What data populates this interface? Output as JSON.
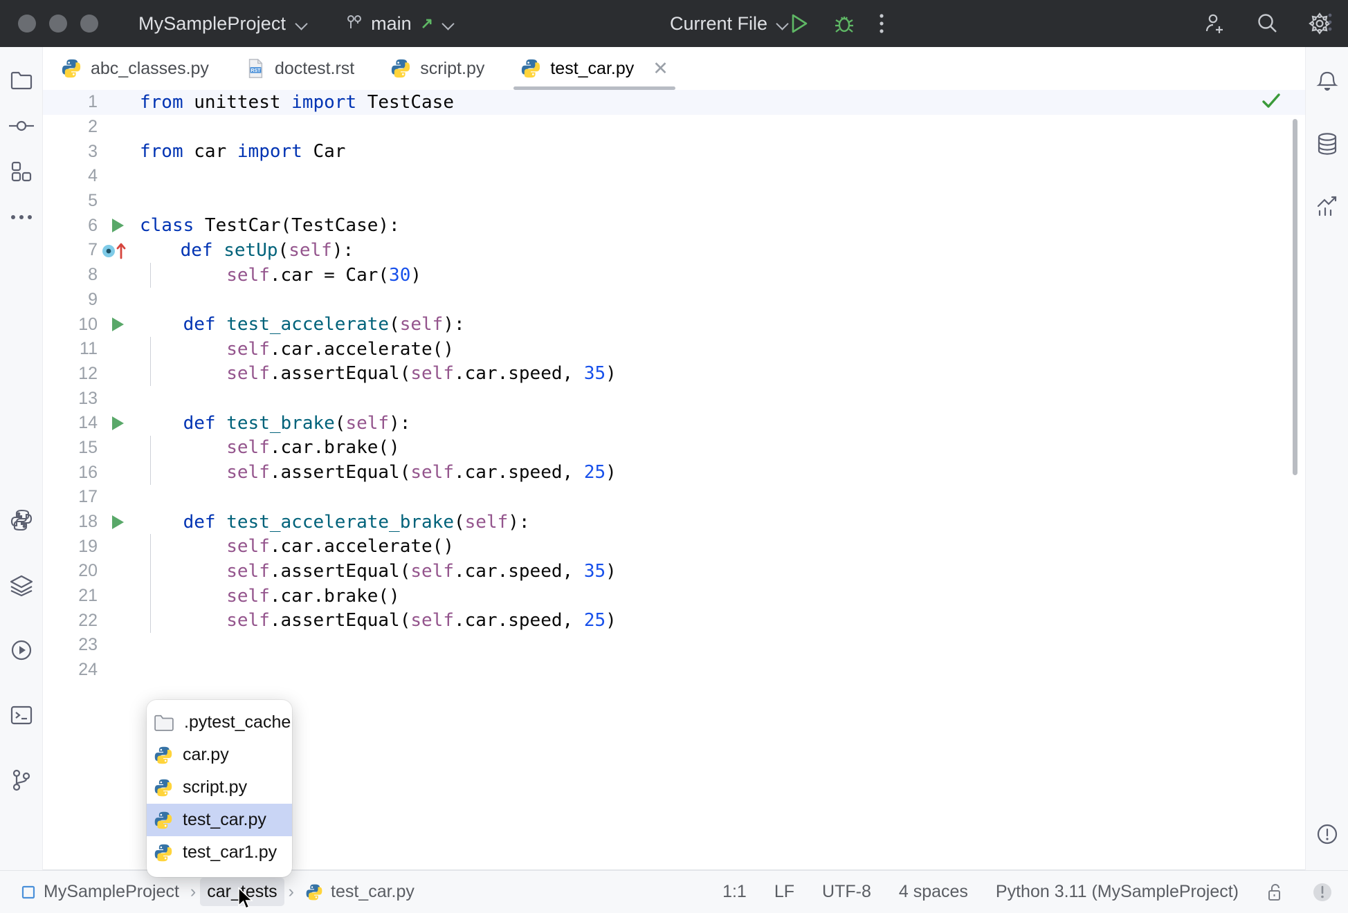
{
  "titlebar": {
    "project": "MySampleProject",
    "branch": "main",
    "branch_icon": "git-branch-icon",
    "branch_sync_icon": "arrow-up-right-icon",
    "run_config": "Current File",
    "run_icon": "run-play-icon",
    "debug_icon": "debug-bug-icon",
    "more_icon": "more-vertical-icon",
    "share_icon": "add-user-icon",
    "search_icon": "search-icon",
    "settings_icon": "gear-icon"
  },
  "left_rail": [
    {
      "name": "project-tool-window",
      "icon": "folder-icon"
    },
    {
      "name": "commit-tool-window",
      "icon": "commit-icon"
    },
    {
      "name": "plugins-tool-window",
      "icon": "plugins-icon"
    },
    {
      "name": "more-tool-windows",
      "icon": "ellipsis-icon"
    },
    {
      "name": "python-packages-tool-window",
      "icon": "python-icon"
    },
    {
      "name": "database-layers-tool-window",
      "icon": "layers-icon"
    },
    {
      "name": "run-tool-window",
      "icon": "run-circle-icon"
    },
    {
      "name": "terminal-tool-window",
      "icon": "terminal-icon"
    },
    {
      "name": "version-control-tool-window",
      "icon": "vcs-branch-icon"
    }
  ],
  "right_rail": [
    {
      "name": "notifications-tool-window",
      "icon": "bell-icon"
    },
    {
      "name": "database-tool-window",
      "icon": "database-icon"
    },
    {
      "name": "profiler-tool-window",
      "icon": "chart-icon"
    },
    {
      "name": "problems-tool-window",
      "icon": "alert-circle-icon"
    }
  ],
  "tabs": [
    {
      "label": "abc_classes.py",
      "icon": "python-file-icon",
      "active": false,
      "closable": false
    },
    {
      "label": "doctest.rst",
      "icon": "rst-file-icon",
      "active": false,
      "closable": false
    },
    {
      "label": "script.py",
      "icon": "python-file-icon",
      "active": false,
      "closable": false
    },
    {
      "label": "test_car.py",
      "icon": "python-file-icon",
      "active": true,
      "closable": true
    }
  ],
  "tabs_more_icon": "more-vertical-icon",
  "editor": {
    "inspection_status_icon": "checkmark-ok-icon",
    "lines": [
      {
        "n": "1",
        "gutter": "",
        "indent": 0,
        "current": true,
        "tokens": [
          {
            "t": "from",
            "c": "kw"
          },
          {
            "t": " unittest ",
            "c": ""
          },
          {
            "t": "import",
            "c": "kw"
          },
          {
            "t": " TestCase",
            "c": ""
          }
        ]
      },
      {
        "n": "2",
        "gutter": "",
        "indent": 0,
        "current": false,
        "tokens": []
      },
      {
        "n": "3",
        "gutter": "",
        "indent": 0,
        "current": false,
        "tokens": [
          {
            "t": "from",
            "c": "kw"
          },
          {
            "t": " car ",
            "c": ""
          },
          {
            "t": "import",
            "c": "kw"
          },
          {
            "t": " Car",
            "c": ""
          }
        ]
      },
      {
        "n": "4",
        "gutter": "",
        "indent": 0,
        "current": false,
        "tokens": []
      },
      {
        "n": "5",
        "gutter": "",
        "indent": 0,
        "current": false,
        "tokens": []
      },
      {
        "n": "6",
        "gutter": "run",
        "indent": 0,
        "current": false,
        "tokens": [
          {
            "t": "class",
            "c": "kw"
          },
          {
            "t": " TestCar(TestCase):",
            "c": ""
          }
        ]
      },
      {
        "n": "7",
        "gutter": "override",
        "indent": 0,
        "current": false,
        "tokens": [
          {
            "t": "    ",
            "c": ""
          },
          {
            "t": "def",
            "c": "kw"
          },
          {
            "t": " ",
            "c": ""
          },
          {
            "t": "setUp",
            "c": "fn"
          },
          {
            "t": "(",
            "c": ""
          },
          {
            "t": "self",
            "c": "slf"
          },
          {
            "t": "):",
            "c": ""
          }
        ]
      },
      {
        "n": "8",
        "gutter": "",
        "indent": 1,
        "current": false,
        "tokens": [
          {
            "t": "        ",
            "c": ""
          },
          {
            "t": "self",
            "c": "slf"
          },
          {
            "t": ".car = Car(",
            "c": ""
          },
          {
            "t": "30",
            "c": "num"
          },
          {
            "t": ")",
            "c": ""
          }
        ]
      },
      {
        "n": "9",
        "gutter": "",
        "indent": 0,
        "current": false,
        "tokens": []
      },
      {
        "n": "10",
        "gutter": "run",
        "indent": 0,
        "current": false,
        "tokens": [
          {
            "t": "    ",
            "c": ""
          },
          {
            "t": "def",
            "c": "kw"
          },
          {
            "t": " ",
            "c": ""
          },
          {
            "t": "test_accelerate",
            "c": "fn"
          },
          {
            "t": "(",
            "c": ""
          },
          {
            "t": "self",
            "c": "slf"
          },
          {
            "t": "):",
            "c": ""
          }
        ]
      },
      {
        "n": "11",
        "gutter": "",
        "indent": 1,
        "current": false,
        "tokens": [
          {
            "t": "        ",
            "c": ""
          },
          {
            "t": "self",
            "c": "slf"
          },
          {
            "t": ".car.accelerate()",
            "c": ""
          }
        ]
      },
      {
        "n": "12",
        "gutter": "",
        "indent": 1,
        "current": false,
        "tokens": [
          {
            "t": "        ",
            "c": ""
          },
          {
            "t": "self",
            "c": "slf"
          },
          {
            "t": ".assertEqual(",
            "c": ""
          },
          {
            "t": "self",
            "c": "slf"
          },
          {
            "t": ".car.speed, ",
            "c": ""
          },
          {
            "t": "35",
            "c": "num"
          },
          {
            "t": ")",
            "c": ""
          }
        ]
      },
      {
        "n": "13",
        "gutter": "",
        "indent": 0,
        "current": false,
        "tokens": []
      },
      {
        "n": "14",
        "gutter": "run",
        "indent": 0,
        "current": false,
        "tokens": [
          {
            "t": "    ",
            "c": ""
          },
          {
            "t": "def",
            "c": "kw"
          },
          {
            "t": " ",
            "c": ""
          },
          {
            "t": "test_brake",
            "c": "fn"
          },
          {
            "t": "(",
            "c": ""
          },
          {
            "t": "self",
            "c": "slf"
          },
          {
            "t": "):",
            "c": ""
          }
        ]
      },
      {
        "n": "15",
        "gutter": "",
        "indent": 1,
        "current": false,
        "tokens": [
          {
            "t": "        ",
            "c": ""
          },
          {
            "t": "self",
            "c": "slf"
          },
          {
            "t": ".car.brake()",
            "c": ""
          }
        ]
      },
      {
        "n": "16",
        "gutter": "",
        "indent": 1,
        "current": false,
        "tokens": [
          {
            "t": "        ",
            "c": ""
          },
          {
            "t": "self",
            "c": "slf"
          },
          {
            "t": ".assertEqual(",
            "c": ""
          },
          {
            "t": "self",
            "c": "slf"
          },
          {
            "t": ".car.speed, ",
            "c": ""
          },
          {
            "t": "25",
            "c": "num"
          },
          {
            "t": ")",
            "c": ""
          }
        ]
      },
      {
        "n": "17",
        "gutter": "",
        "indent": 0,
        "current": false,
        "tokens": []
      },
      {
        "n": "18",
        "gutter": "run",
        "indent": 0,
        "current": false,
        "tokens": [
          {
            "t": "    ",
            "c": ""
          },
          {
            "t": "def",
            "c": "kw"
          },
          {
            "t": " ",
            "c": ""
          },
          {
            "t": "test_accelerate_brake",
            "c": "fn"
          },
          {
            "t": "(",
            "c": ""
          },
          {
            "t": "self",
            "c": "slf"
          },
          {
            "t": "):",
            "c": ""
          }
        ]
      },
      {
        "n": "19",
        "gutter": "",
        "indent": 1,
        "current": false,
        "tokens": [
          {
            "t": "        ",
            "c": ""
          },
          {
            "t": "self",
            "c": "slf"
          },
          {
            "t": ".car.accelerate()",
            "c": ""
          }
        ]
      },
      {
        "n": "20",
        "gutter": "",
        "indent": 1,
        "current": false,
        "tokens": [
          {
            "t": "        ",
            "c": ""
          },
          {
            "t": "self",
            "c": "slf"
          },
          {
            "t": ".assertEqual(",
            "c": ""
          },
          {
            "t": "self",
            "c": "slf"
          },
          {
            "t": ".car.speed, ",
            "c": ""
          },
          {
            "t": "35",
            "c": "num"
          },
          {
            "t": ")",
            "c": ""
          }
        ]
      },
      {
        "n": "21",
        "gutter": "",
        "indent": 1,
        "current": false,
        "tokens": [
          {
            "t": "        ",
            "c": ""
          },
          {
            "t": "self",
            "c": "slf"
          },
          {
            "t": ".car.brake()",
            "c": ""
          }
        ]
      },
      {
        "n": "22",
        "gutter": "",
        "indent": 1,
        "current": false,
        "tokens": [
          {
            "t": "        ",
            "c": ""
          },
          {
            "t": "self",
            "c": "slf"
          },
          {
            "t": ".assertEqual(",
            "c": ""
          },
          {
            "t": "self",
            "c": "slf"
          },
          {
            "t": ".car.speed, ",
            "c": ""
          },
          {
            "t": "25",
            "c": "num"
          },
          {
            "t": ")",
            "c": ""
          }
        ]
      },
      {
        "n": "23",
        "gutter": "",
        "indent": 0,
        "current": false,
        "tokens": []
      },
      {
        "n": "24",
        "gutter": "",
        "indent": 0,
        "current": false,
        "tokens": []
      }
    ]
  },
  "popup": {
    "items": [
      {
        "label": ".pytest_cache",
        "icon": "folder-icon",
        "selected": false
      },
      {
        "label": "car.py",
        "icon": "python-file-icon",
        "selected": false
      },
      {
        "label": "script.py",
        "icon": "python-file-icon",
        "selected": false
      },
      {
        "label": "test_car.py",
        "icon": "python-file-icon",
        "selected": true
      },
      {
        "label": "test_car1.py",
        "icon": "python-file-icon",
        "selected": false
      }
    ]
  },
  "statusbar": {
    "breadcrumb": [
      {
        "label": "MySampleProject",
        "icon": "module-icon",
        "highlighted": false
      },
      {
        "label": "car_tests",
        "icon": "",
        "highlighted": true
      },
      {
        "label": "test_car.py",
        "icon": "python-file-icon",
        "highlighted": false
      }
    ],
    "caret": "1:1",
    "line_separator": "LF",
    "encoding": "UTF-8",
    "indent": "4 spaces",
    "interpreter": "Python 3.11 (MySampleProject)",
    "lock_icon": "unlocked-padlock-icon",
    "problems_icon": "alert-circle-icon"
  },
  "colors": {
    "titlebar_bg": "#2b2d30",
    "rail_bg": "#f7f8fa",
    "editor_bg": "#ffffff",
    "current_line_bg": "#f5f7fd",
    "keyword": "#0033b3",
    "function": "#00627a",
    "self": "#94558d",
    "number": "#1750eb",
    "selection": "#c9d5f5",
    "run_green": "#59a869"
  }
}
